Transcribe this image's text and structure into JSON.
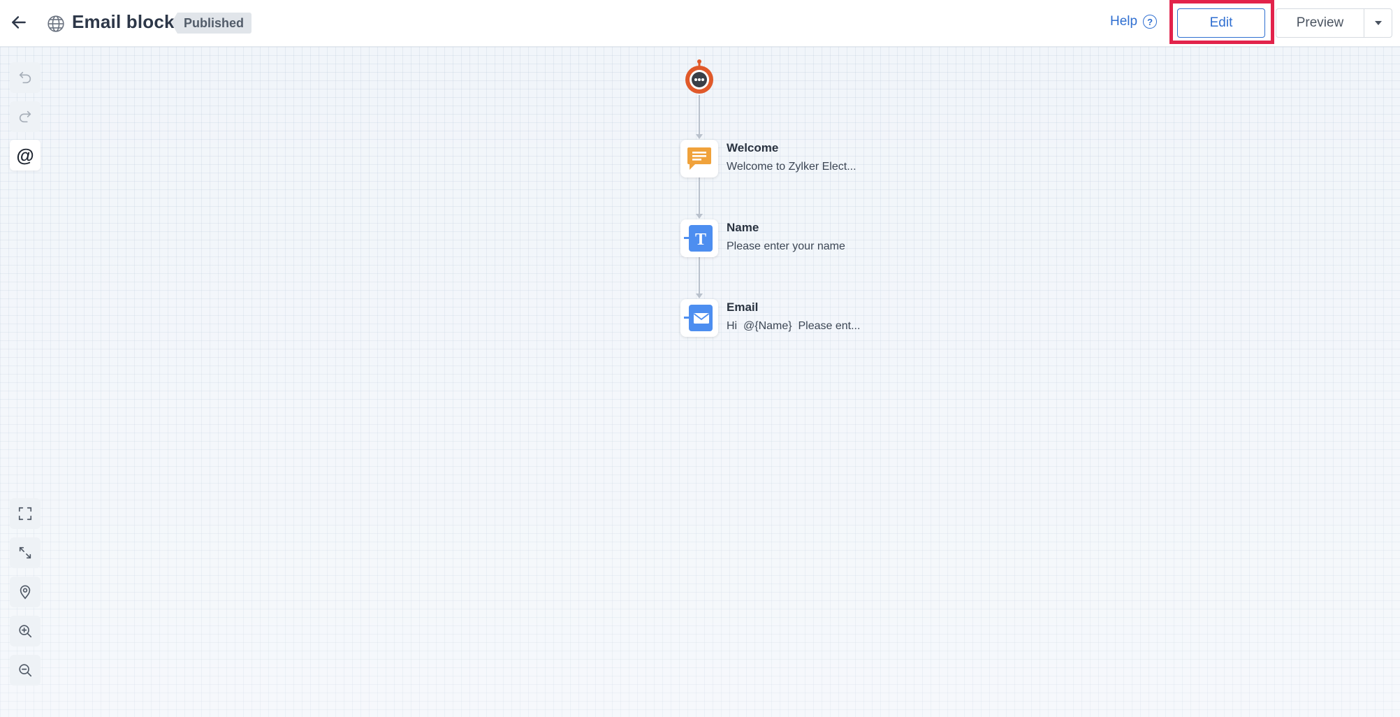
{
  "header": {
    "back_icon": "arrow-left-icon",
    "globe_icon": "globe-icon",
    "title": "Email block",
    "status_badge": "Published",
    "help_label": "Help",
    "help_icon_glyph": "?",
    "edit_label": "Edit",
    "preview_label": "Preview",
    "dropdown_icon": "caret-down-icon"
  },
  "colors": {
    "accent": "#2f6fd1",
    "highlight": "#e2234b",
    "bot": "#e0592a",
    "message_node": "#f0a23b",
    "input_node": "#4d8ef0"
  },
  "toolbar": {
    "top": [
      "undo-icon",
      "redo-icon",
      "mention-icon"
    ],
    "mention_glyph": "@",
    "bottom": [
      "fullscreen-icon",
      "fit-to-screen-icon",
      "locate-icon",
      "zoom-in-icon",
      "zoom-out-icon"
    ]
  },
  "flow": {
    "start_icon": "bot-icon",
    "nodes": [
      {
        "title": "Welcome",
        "subtitle": "Welcome to Zylker Elect...",
        "icon": "message-icon"
      },
      {
        "title": "Name",
        "subtitle": "Please enter your name",
        "icon": "text-input-icon",
        "icon_glyph": "T"
      },
      {
        "title": "Email",
        "subtitle": "Hi  @{Name}  Please ent...",
        "icon": "email-input-icon"
      }
    ]
  }
}
